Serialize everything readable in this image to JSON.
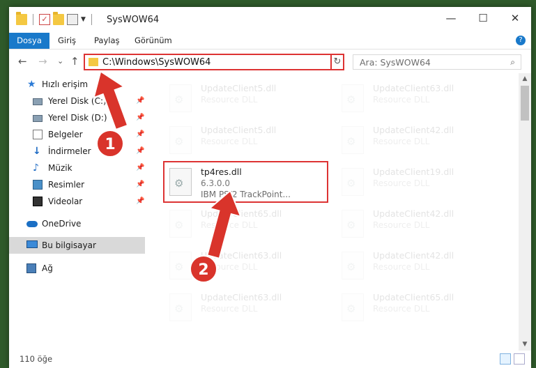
{
  "titlebar": {
    "title": "SysWOW64",
    "minimize": "—",
    "maximize": "☐",
    "close": "✕"
  },
  "ribbon": {
    "tabs": [
      "Dosya",
      "Giriş",
      "Paylaş",
      "Görünüm"
    ],
    "help": "?"
  },
  "address": {
    "path": "C:\\Windows\\SysWOW64",
    "chevron": "⌵",
    "refresh": "↻"
  },
  "search": {
    "placeholder": "Ara: SysWOW64",
    "icon": "⌕"
  },
  "nav": {
    "back": "←",
    "forward": "→",
    "recent": "⌄",
    "up": "↑"
  },
  "sidebar": {
    "items": [
      {
        "label": "Hızlı erişim",
        "icon": "star-icon",
        "pinned": false
      },
      {
        "label": "Yerel Disk (C:)",
        "icon": "disk-icon",
        "pinned": true
      },
      {
        "label": "Yerel Disk (D:)",
        "icon": "disk-icon",
        "pinned": true
      },
      {
        "label": "Belgeler",
        "icon": "document-icon",
        "pinned": true
      },
      {
        "label": "İndirmeler",
        "icon": "download-icon",
        "pinned": true
      },
      {
        "label": "Müzik",
        "icon": "music-icon",
        "pinned": true
      },
      {
        "label": "Resimler",
        "icon": "pictures-icon",
        "pinned": true
      },
      {
        "label": "Videolar",
        "icon": "video-icon",
        "pinned": true
      },
      {
        "label": "OneDrive",
        "icon": "cloud-icon",
        "pinned": false
      },
      {
        "label": "Bu bilgisayar",
        "icon": "computer-icon",
        "pinned": false,
        "selected": true
      },
      {
        "label": "Ağ",
        "icon": "network-icon",
        "pinned": false
      }
    ],
    "pin_glyph": "📌"
  },
  "files": {
    "left": [
      {
        "name": "UpdateClient5.dll",
        "type": "Resource DLL",
        "faded": true
      },
      {
        "name": "UpdateClient5.dll",
        "type": "Resource DLL",
        "faded": true
      },
      {
        "name": "tp4res.dll",
        "type": "6.3.0.0",
        "extra": "IBM PS/2 TrackPoint...",
        "faded": false
      },
      {
        "name": "UpdateClient65.dll",
        "type": "Resource DLL",
        "faded": true
      },
      {
        "name": "UpdateClient63.dll",
        "type": "Resource DLL",
        "faded": true
      },
      {
        "name": "UpdateClient63.dll",
        "type": "Resource DLL",
        "faded": true
      }
    ],
    "right": [
      {
        "name": "UpdateClient63.dll",
        "type": "Resource DLL",
        "faded": true
      },
      {
        "name": "UpdateClient42.dll",
        "type": "Resource DLL",
        "faded": true
      },
      {
        "name": "UpdateClient19.dll",
        "type": "Resource DLL",
        "faded": true
      },
      {
        "name": "UpdateClient42.dll",
        "type": "Resource DLL",
        "faded": true
      },
      {
        "name": "UpdateClient42.dll",
        "type": "Resource DLL",
        "faded": true
      },
      {
        "name": "UpdateClient65.dll",
        "type": "Resource DLL",
        "faded": true
      }
    ]
  },
  "status": {
    "count": "110 öğe"
  },
  "annotations": {
    "step1": "1",
    "step2": "2",
    "color": "#d9342b"
  }
}
